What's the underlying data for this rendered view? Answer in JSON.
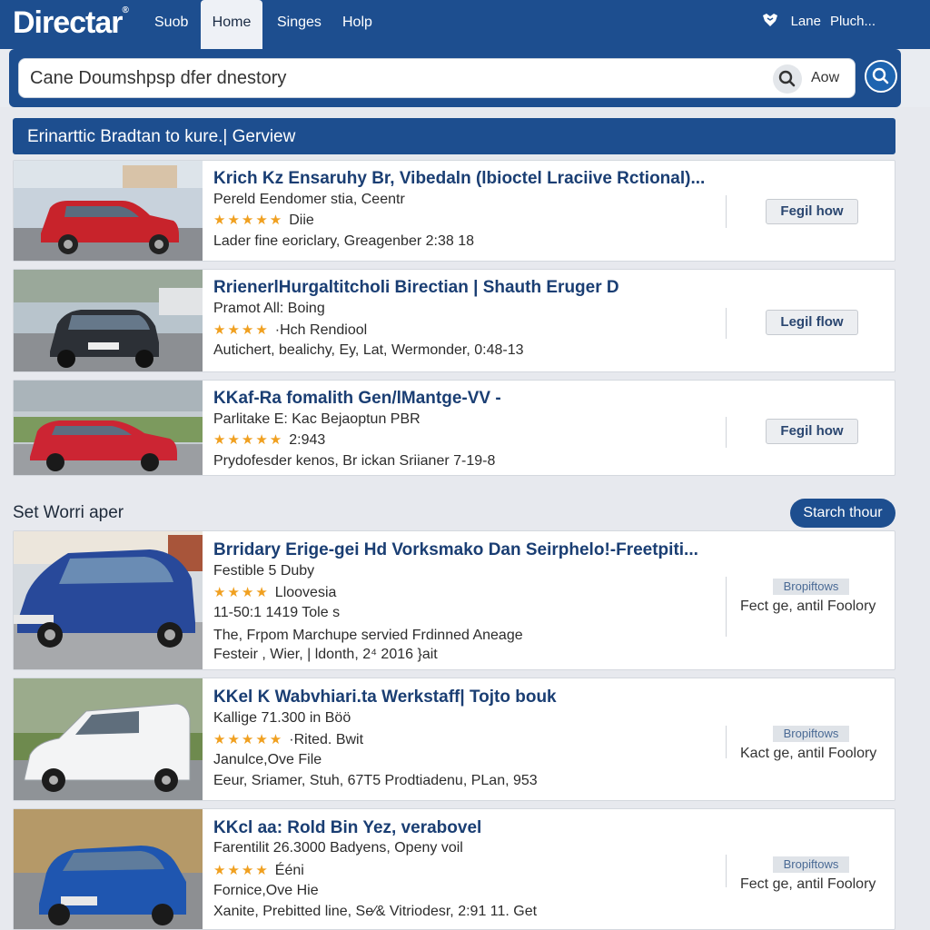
{
  "brand": {
    "logo": "Directar",
    "mark": "®"
  },
  "nav": {
    "items": [
      {
        "label": "Suob"
      },
      {
        "label": "Home"
      },
      {
        "label": "Singes"
      },
      {
        "label": "Holp"
      }
    ],
    "user_label": "Lane",
    "user_extra": "Pluch..."
  },
  "search": {
    "placeholder": "Cane Doumshpsр dfer dnestory",
    "aow_label": "Aow"
  },
  "section": {
    "title": "Erinarttic Bradtan to kure.| Gerview"
  },
  "listings_top": [
    {
      "title": "Krich Kz Ensaruhy Br, Vibedaln (lbioctel Lraciive Rctional)...",
      "line1": "Pereld Eendomer stia, Ceentr",
      "stars": "★★★★★",
      "rating_text": "Diie",
      "line3": "Lader fine eoriclary, Greagenber 2:38 18",
      "button": "Fegil how"
    },
    {
      "title": "RrienerlHurgaltitcholi Birectian | Shauth Eruger D",
      "line1": "Pramot All: Boing",
      "stars": "★★★★",
      "rating_text": "·Hch Rendiool",
      "line3": "Autichert, bealichy, Ey, Lat, Wermonder, 0:48-13",
      "button": "Legil flow"
    },
    {
      "title": "KKaf-Ra fomalith Gen/lMantge-VV -",
      "line1": "Parlitake E: Kac Bejaoptun PBR",
      "stars": "★★★★★",
      "rating_text": "2:943",
      "line3": "Prydofesder kenos, Br ickan Sriianer 7-19-8",
      "button": "Fegil how"
    }
  ],
  "middle": {
    "title": "Set Worri aper",
    "button": "Starch thour"
  },
  "listings_bottom": [
    {
      "title": "Brridary Erige-gei Hd Vorksmako Dan Seirphelo!-Freetpiti...",
      "line1": "Festible 5 Duby",
      "stars": "★★★★",
      "rating_text": "Lloovesia",
      "line3": "11-50:1 1419 Tole s",
      "line4": "The, Frpom Marchupe servied Frdinned Aneage",
      "line5": "Festeir , Wier, | ldonth, 2⁴ 2016 }ait",
      "tag": "Bropiftows",
      "side": "Fect ge, antil Foolory"
    },
    {
      "title": "KKel K Wabvhiari.ta Werkstaff| Tojto bouk",
      "line1": "Kallige 71.300 in Böö",
      "stars": "★★★★★",
      "rating_text": "·Rited. Bwit",
      "line3": "Janulce,Ove File",
      "line4": "Eeur, Sriamer, Stuh, 67T5 Prodtiadenu, PLan, 953",
      "tag": "Bropiftows",
      "side": "Kact ge, antil Foolory"
    },
    {
      "title": "KKcl aa: Rold Bin Yez, verabovel",
      "line1": "Farentilit 26.3000 Badyens, Openy voil",
      "stars": "★★★★",
      "rating_text": "Ééni",
      "line3": "Fornice,Ove Hie",
      "line4": "Xanite, Prebitted line, Se⁄& Vitriodesr, 2:91 11. Get",
      "tag": "Bropiftows",
      "side": "Fect ge, antil Foolory"
    }
  ],
  "colors": {
    "brand_blue": "#1d4e8f",
    "title_blue": "#1a3e73",
    "star": "#f0a020"
  }
}
